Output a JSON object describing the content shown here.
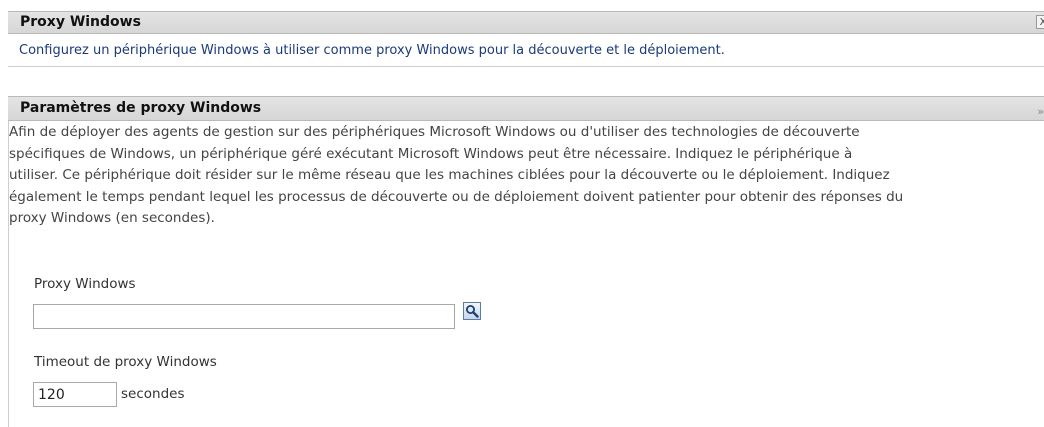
{
  "panel": {
    "title": "Proxy Windows",
    "close_glyph": "X",
    "description": "Configurez un périphérique Windows à utiliser comme proxy Windows pour la découverte et le déploiement."
  },
  "section": {
    "title": "Paramètres de proxy Windows",
    "collapse_glyph": "»",
    "paragraph_lines": [
      "Afin de déployer des agents de gestion sur des périphériques Microsoft Windows ou d'utiliser des technologies de découverte",
      "spécifiques de Windows, un périphérique géré exécutant Microsoft Windows peut être nécessaire. Indiquez le périphérique à",
      "utiliser. Ce périphérique doit résider sur le même réseau que les machines ciblées pour la découverte ou le déploiement. Indiquez",
      "également le temps pendant lequel les processus de découverte ou de déploiement doivent patienter pour obtenir des réponses du",
      "proxy Windows (en secondes)."
    ]
  },
  "form": {
    "proxy_label": "Proxy Windows",
    "proxy_value": "",
    "timeout_label": "Timeout de proxy Windows",
    "timeout_value": "120",
    "timeout_unit": "secondes"
  },
  "icons": {
    "browse": "search-magnifier-icon",
    "close": "close-icon",
    "collapse": "collapse-chevron-icon"
  }
}
